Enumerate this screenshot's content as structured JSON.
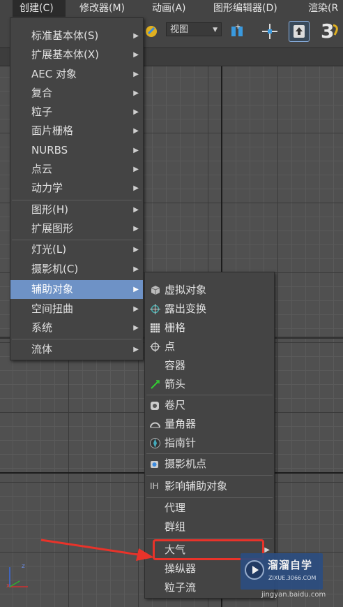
{
  "menubar": {
    "items": [
      "创建(C)",
      "修改器(M)",
      "动画(A)",
      "图形编辑器(D)",
      "渲染(R"
    ]
  },
  "toolbar": {
    "view_select": "视图",
    "snap_label": "3"
  },
  "create_menu": {
    "items": [
      {
        "label": "标准基本体(S)"
      },
      {
        "label": "扩展基本体(X)"
      },
      {
        "label": "AEC 对象"
      },
      {
        "label": "复合"
      },
      {
        "label": "粒子"
      },
      {
        "label": "面片栅格"
      },
      {
        "label": "NURBS"
      },
      {
        "label": "点云"
      },
      {
        "label": "动力学"
      },
      {
        "label": "图形(H)"
      },
      {
        "label": "扩展图形"
      },
      {
        "label": "灯光(L)"
      },
      {
        "label": "摄影机(C)"
      },
      {
        "label": "辅助对象"
      },
      {
        "label": "空间扭曲"
      },
      {
        "label": "系统"
      },
      {
        "label": "流体"
      }
    ]
  },
  "helpers_menu": {
    "items": [
      {
        "label": "虚拟对象",
        "icon": "dummy-cube-icon"
      },
      {
        "label": "露出变换",
        "icon": "expose-transform-icon"
      },
      {
        "label": "栅格",
        "icon": "grid-icon"
      },
      {
        "label": "点",
        "icon": "point-icon"
      },
      {
        "label": "容器",
        "icon": ""
      },
      {
        "label": "箭头",
        "icon": "arrow-helper-icon"
      },
      {
        "label": "卷尺",
        "icon": "tape-icon"
      },
      {
        "label": "量角器",
        "icon": "protractor-icon"
      },
      {
        "label": "指南针",
        "icon": "compass-icon"
      },
      {
        "label": "摄影机点",
        "icon": "camera-point-icon"
      },
      {
        "label": "影响辅助对象",
        "icon": "ih-icon"
      },
      {
        "label": "代理",
        "icon": ""
      },
      {
        "label": "群组",
        "icon": ""
      },
      {
        "label": "大气",
        "icon": ""
      },
      {
        "label": "操纵器",
        "icon": ""
      },
      {
        "label": "粒子流",
        "icon": ""
      }
    ]
  },
  "ih_text": "IH",
  "watermark": {
    "title": "溜溜自学",
    "url": "ZIXUE.3066.COM",
    "site": "jingyan.baidu.com"
  },
  "axis": {
    "z": "z",
    "x": "x"
  },
  "colors": {
    "highlight": "#6e92c6",
    "annotation": "#e8332a",
    "watermark_bg": "#2c4d80"
  }
}
